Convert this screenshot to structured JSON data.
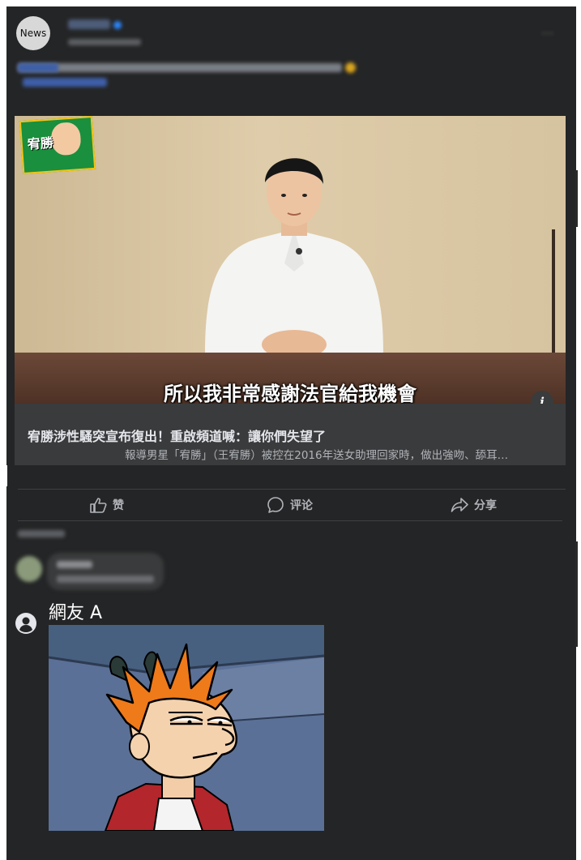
{
  "post": {
    "avatar_text": "News",
    "more_icon": "more-dots-icon",
    "dots": "···"
  },
  "video": {
    "subtitle": "所以我非常感謝法官給我機會",
    "logo_text": "宥勝",
    "info_label": "i"
  },
  "link": {
    "title": "宥勝涉性騷突宣布復出！重啟頻道喊：讓你們失望了",
    "description": "報導男星「宥勝」（王宥勝）被控在2016年送女助理回家時，做出強吻、舔耳…"
  },
  "actions": [
    {
      "label": "赞",
      "icon": "thumbs-up-icon"
    },
    {
      "label": "评论",
      "icon": "comment-icon"
    },
    {
      "label": "分享",
      "icon": "share-icon"
    }
  ],
  "comment": {
    "user_name": "網友 A",
    "user_icon": "user-avatar-icon",
    "image": "futurama-fry-meme"
  },
  "colors": {
    "background": "#242526",
    "link_box": "#3a3b3c",
    "text": "#e4e6eb",
    "secondary_text": "#b0b3b8",
    "accent": "#2d88ff"
  }
}
